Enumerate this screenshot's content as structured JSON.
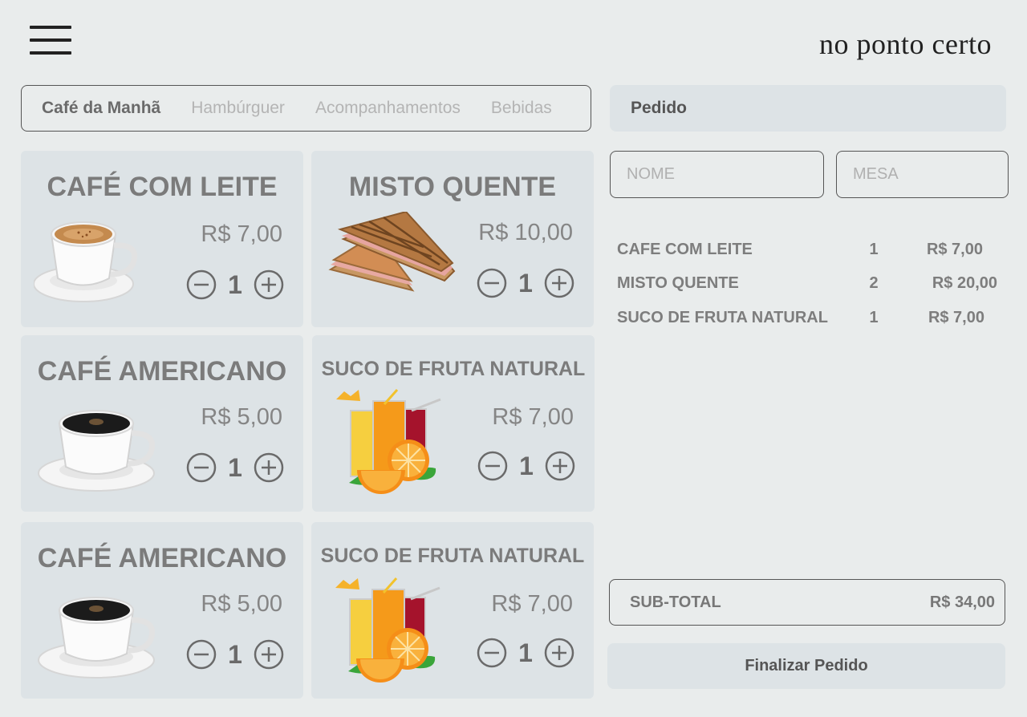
{
  "header": {
    "logo": "no ponto certo",
    "menu_icon": "hamburger-menu-icon"
  },
  "tabs": [
    {
      "label": "Café da Manhã",
      "active": true
    },
    {
      "label": "Hambúrguer",
      "active": false
    },
    {
      "label": "Acompanhamentos",
      "active": false
    },
    {
      "label": "Bebidas",
      "active": false
    }
  ],
  "products": [
    {
      "name": "CAFÉ COM LEITE",
      "price": "R$ 7,00",
      "quantity": "1",
      "image": "coffee-with-milk-image"
    },
    {
      "name": "MISTO QUENTE",
      "price": "R$ 10,00",
      "quantity": "1",
      "image": "ham-cheese-sandwich-image"
    },
    {
      "name": "CAFÉ AMERICANO",
      "price": "R$ 5,00",
      "quantity": "1",
      "image": "black-coffee-image"
    },
    {
      "name": "SUCO DE FRUTA NATURAL",
      "price": "R$ 7,00",
      "quantity": "1",
      "image": "fruit-juice-image"
    },
    {
      "name": "CAFÉ AMERICANO",
      "price": "R$ 5,00",
      "quantity": "1",
      "image": "black-coffee-image"
    },
    {
      "name": "SUCO DE FRUTA NATURAL",
      "price": "R$ 7,00",
      "quantity": "1",
      "image": "fruit-juice-image"
    }
  ],
  "order": {
    "title": "Pedido",
    "name_placeholder": "NOME",
    "table_placeholder": "MESA",
    "items": [
      {
        "name": "CAFE COM LEITE",
        "qty": "1",
        "price": "R$ 7,00"
      },
      {
        "name": "MISTO QUENTE",
        "qty": "2",
        "price": "R$ 20,00"
      },
      {
        "name": "SUCO DE FRUTA NATURAL",
        "qty": "1",
        "price": "R$ 7,00"
      }
    ],
    "subtotal_label": "SUB-TOTAL",
    "subtotal_value": "R$ 34,00",
    "finalize_label": "Finalizar Pedido"
  },
  "colors": {
    "background": "#e9ecec",
    "card": "#dde3e6",
    "text": "#777777",
    "border": "#555555"
  }
}
